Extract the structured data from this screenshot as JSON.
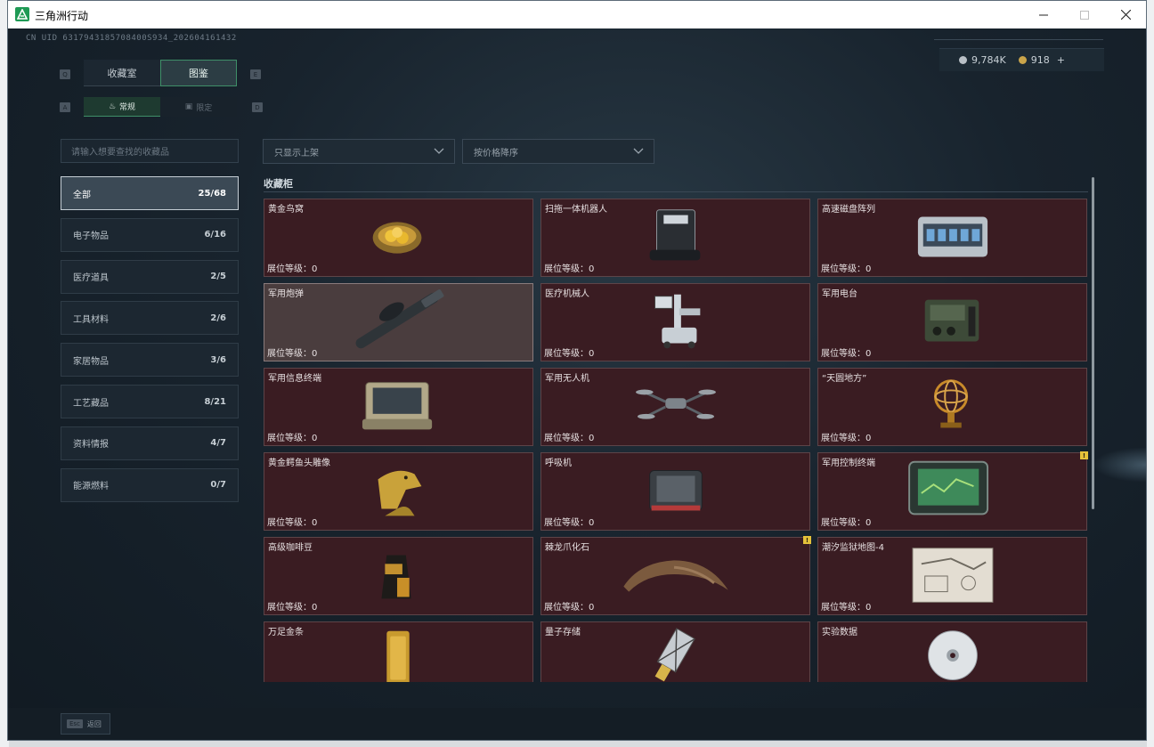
{
  "window": {
    "title": "三角洲行动"
  },
  "header": {
    "uid": "CN UID 6317943185708400S934_202604161432",
    "silver": "9,784K",
    "gold": "918",
    "plus": "+"
  },
  "tabs": {
    "key_left": "Q",
    "key_right": "E",
    "items": [
      {
        "label": "收藏室",
        "active": false
      },
      {
        "label": "图鉴",
        "active": true
      }
    ]
  },
  "subtabs": {
    "key_left": "A",
    "key_right": "D",
    "items": [
      {
        "label": "常规",
        "active": true
      },
      {
        "label": "限定",
        "active": false
      }
    ]
  },
  "search": {
    "placeholder": "请输入想要查找的收藏品"
  },
  "filters": {
    "listing": "只显示上架",
    "sort": "按价格降序"
  },
  "categories": [
    {
      "label": "全部",
      "count": "25/68",
      "active": true
    },
    {
      "label": "电子物品",
      "count": "6/16"
    },
    {
      "label": "医疗道具",
      "count": "2/5"
    },
    {
      "label": "工具材料",
      "count": "2/6"
    },
    {
      "label": "家居物品",
      "count": "3/6"
    },
    {
      "label": "工艺藏品",
      "count": "8/21"
    },
    {
      "label": "资料情报",
      "count": "4/7"
    },
    {
      "label": "能源燃料",
      "count": "0/7"
    }
  ],
  "section": {
    "title": "收藏柜"
  },
  "items": [
    {
      "name": "黄金鸟窝",
      "level": "展位等级：0",
      "icon": "golden-nest-icon"
    },
    {
      "name": "扫拖一体机器人",
      "level": "展位等级：0",
      "icon": "robot-vacuum-icon"
    },
    {
      "name": "高速磁盘阵列",
      "level": "展位等级：0",
      "icon": "disk-array-icon"
    },
    {
      "name": "军用炮弹",
      "level": "展位等级：0",
      "icon": "artillery-shell-icon",
      "highlight": true
    },
    {
      "name": "医疗机械人",
      "level": "展位等级：0",
      "icon": "medical-robot-icon"
    },
    {
      "name": "军用电台",
      "level": "展位等级：0",
      "icon": "military-radio-icon"
    },
    {
      "name": "军用信息终端",
      "level": "展位等级：0",
      "icon": "info-terminal-icon"
    },
    {
      "name": "军用无人机",
      "level": "展位等级：0",
      "icon": "drone-icon"
    },
    {
      "name": "“天圆地方”",
      "level": "展位等级：0",
      "icon": "armillary-sphere-icon"
    },
    {
      "name": "黄金鳄鱼头雕像",
      "level": "展位等级：0",
      "icon": "crocodile-statue-icon"
    },
    {
      "name": "呼吸机",
      "level": "展位等级：0",
      "icon": "ventilator-icon"
    },
    {
      "name": "军用控制终端",
      "level": "展位等级：0",
      "icon": "control-terminal-icon",
      "alert": "!"
    },
    {
      "name": "高级咖啡豆",
      "level": "展位等级：0",
      "icon": "coffee-bag-icon"
    },
    {
      "name": "棘龙爪化石",
      "level": "展位等级：0",
      "icon": "claw-fossil-icon",
      "alert": "!"
    },
    {
      "name": "潮汐监狱地图-4",
      "level": "展位等级：0",
      "icon": "prison-map-icon"
    },
    {
      "name": "万足金条",
      "level": "展位等级：0",
      "icon": "gold-bar-icon"
    },
    {
      "name": "量子存储",
      "level": "展位等级：0",
      "icon": "quantum-storage-icon"
    },
    {
      "name": "实验数据",
      "level": "展位等级：0",
      "icon": "data-disc-icon"
    }
  ],
  "footer": {
    "esc_key": "Esc",
    "back": "返回"
  }
}
